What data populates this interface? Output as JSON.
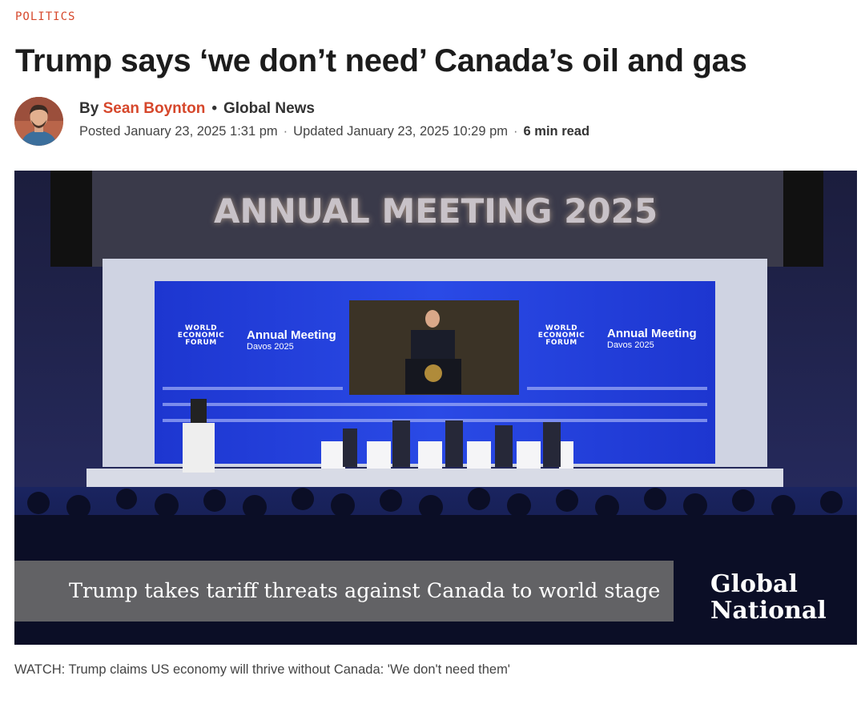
{
  "article": {
    "category": "POLITICS",
    "headline": "Trump says ‘we don’t need’ Canada’s oil and gas",
    "byline_prefix": "By",
    "author": "Sean Boynton",
    "byline_separator": "•",
    "outlet": "Global News",
    "posted": "Posted January 23, 2025 1:31 pm",
    "meta_separator": "·",
    "updated": "Updated January 23, 2025 10:29 pm",
    "read_time": "6 min read"
  },
  "video": {
    "banner": "ANNUAL MEETING 2025",
    "wef_logo": "WORLD ECONOMIC FORUM",
    "screen_title": "Annual Meeting",
    "screen_subtitle": "Davos 2025",
    "lower_third": "Trump takes tariff threats against Canada to world stage",
    "brand_line1": "Global",
    "brand_line2": "National"
  },
  "caption": "WATCH: Trump claims US economy will thrive without Canada: 'We don't need them'",
  "colors": {
    "accent": "#d6472b",
    "stage_blue": "#1f3fd8"
  }
}
